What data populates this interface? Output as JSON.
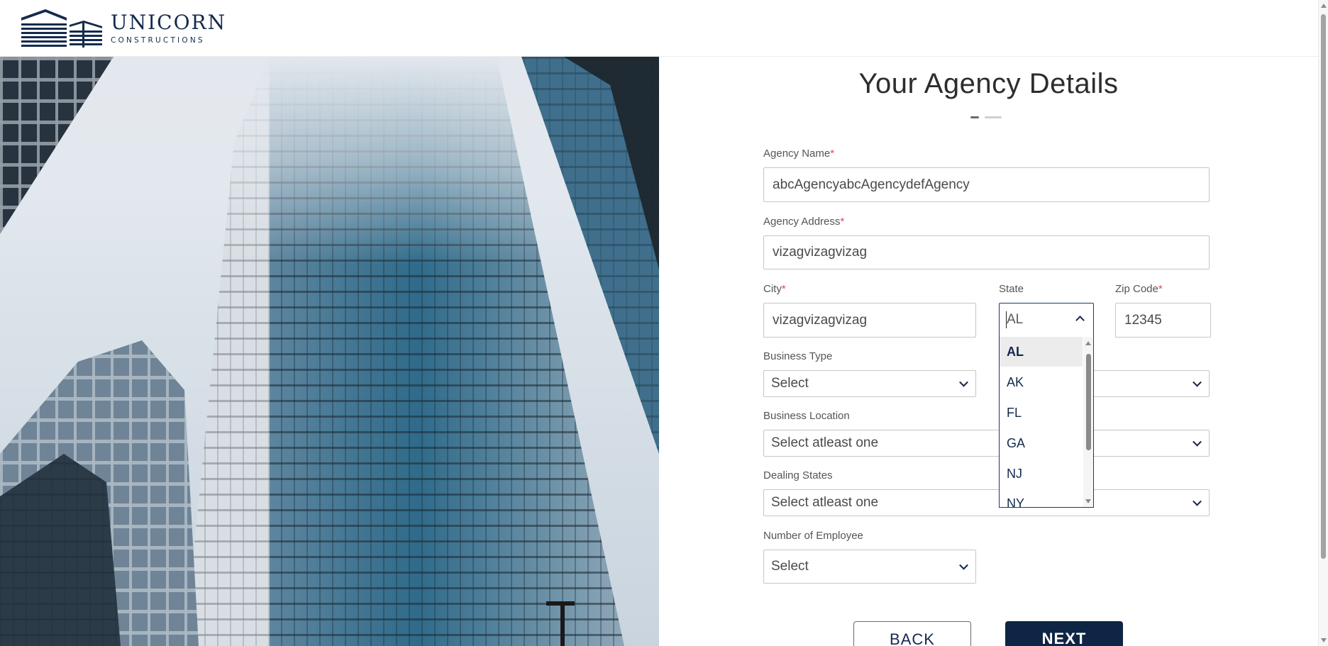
{
  "header": {
    "logo_name": "UNICORN",
    "logo_sub": "CONSTRUCTIONS"
  },
  "form": {
    "title": "Your Agency Details",
    "agency_name": {
      "label": "Agency Name",
      "value": "abcAgencyabcAgencydefAgency",
      "required": "*"
    },
    "agency_address": {
      "label": "Agency Address",
      "value": "vizagvizagvizag",
      "required": "*"
    },
    "city": {
      "label": "City",
      "value": "vizagvizagvizag",
      "required": "*"
    },
    "state": {
      "label": "State",
      "value": "AL",
      "options": [
        "AL",
        "AK",
        "FL",
        "GA",
        "NJ",
        "NY"
      ]
    },
    "zip": {
      "label": "Zip Code",
      "value": "12345",
      "required": "*"
    },
    "business_type": {
      "label": "Business Type",
      "value": "Select"
    },
    "business_location": {
      "label": "Business Location",
      "value": "Select atleast one"
    },
    "dealing_states": {
      "label": "Dealing States",
      "value": "Select atleast one"
    },
    "employees": {
      "label": "Number of Employee",
      "value": "Select"
    }
  },
  "buttons": {
    "back": "BACK",
    "next": "NEXT"
  },
  "colors": {
    "brand": "#0f2545",
    "required": "#e0474c"
  }
}
